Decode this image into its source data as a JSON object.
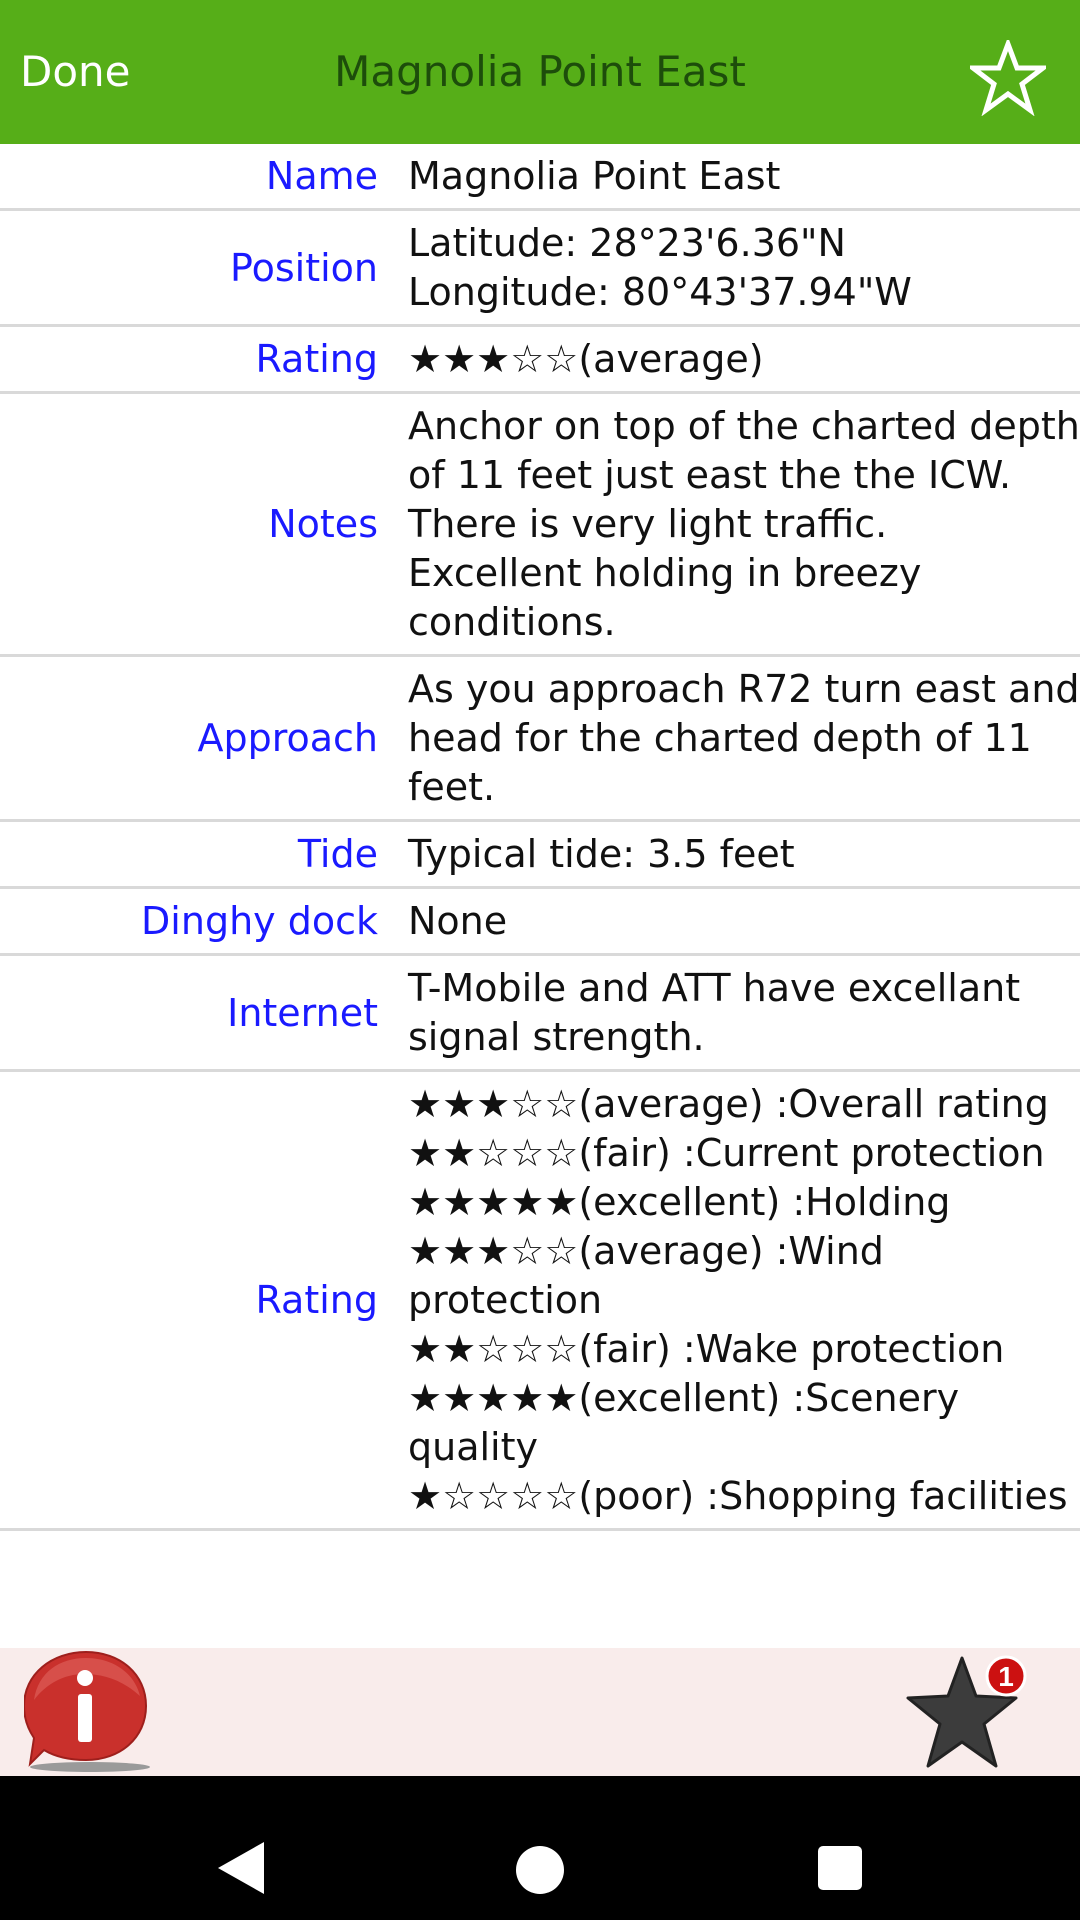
{
  "header": {
    "done_label": "Done",
    "title": "Magnolia Point East",
    "favorite_icon": "star-outline-icon",
    "background": "#56ae18"
  },
  "details": [
    {
      "label": "Name",
      "value": "Magnolia Point East"
    },
    {
      "label": "Position",
      "value": "Latitude: 28°23'6.36\"N\nLongitude: 80°43'37.94\"W"
    },
    {
      "label": "Rating",
      "value": "★★★☆☆(average)"
    },
    {
      "label": "Notes",
      "value": "Anchor on top of the charted depth of 11 feet just east the the ICW.  There is very light traffic.  Excellent holding in breezy conditions."
    },
    {
      "label": "Approach",
      "value": "As you approach R72 turn east and head for the charted depth of 11 feet."
    },
    {
      "label": "Tide",
      "value": "Typical tide: 3.5 feet"
    },
    {
      "label": "Dinghy dock",
      "value": "None"
    },
    {
      "label": "Internet",
      "value": "T-Mobile and ATT have excellant signal strength."
    },
    {
      "label": "Rating",
      "value": "★★★☆☆(average) :Overall rating\n★★☆☆☆(fair) :Current protection\n★★★★★(excellent) :Holding\n★★★☆☆(average) :Wind protection\n★★☆☆☆(fair) :Wake protection\n★★★★★(excellent) :Scenery quality\n★☆☆☆☆(poor) :Shopping facilities"
    }
  ],
  "bottom_bar": {
    "info_icon": "info-icon",
    "star_icon": "star-icon",
    "badge_count": "1"
  },
  "navigation": {
    "back_icon": "back-triangle-icon",
    "home_icon": "home-circle-icon",
    "recents_icon": "recents-square-icon"
  },
  "colors": {
    "header_bg": "#56ae18",
    "label": "#1a1aff",
    "bottom_bar_bg": "#f9eceb",
    "badge": "#cc1111"
  }
}
